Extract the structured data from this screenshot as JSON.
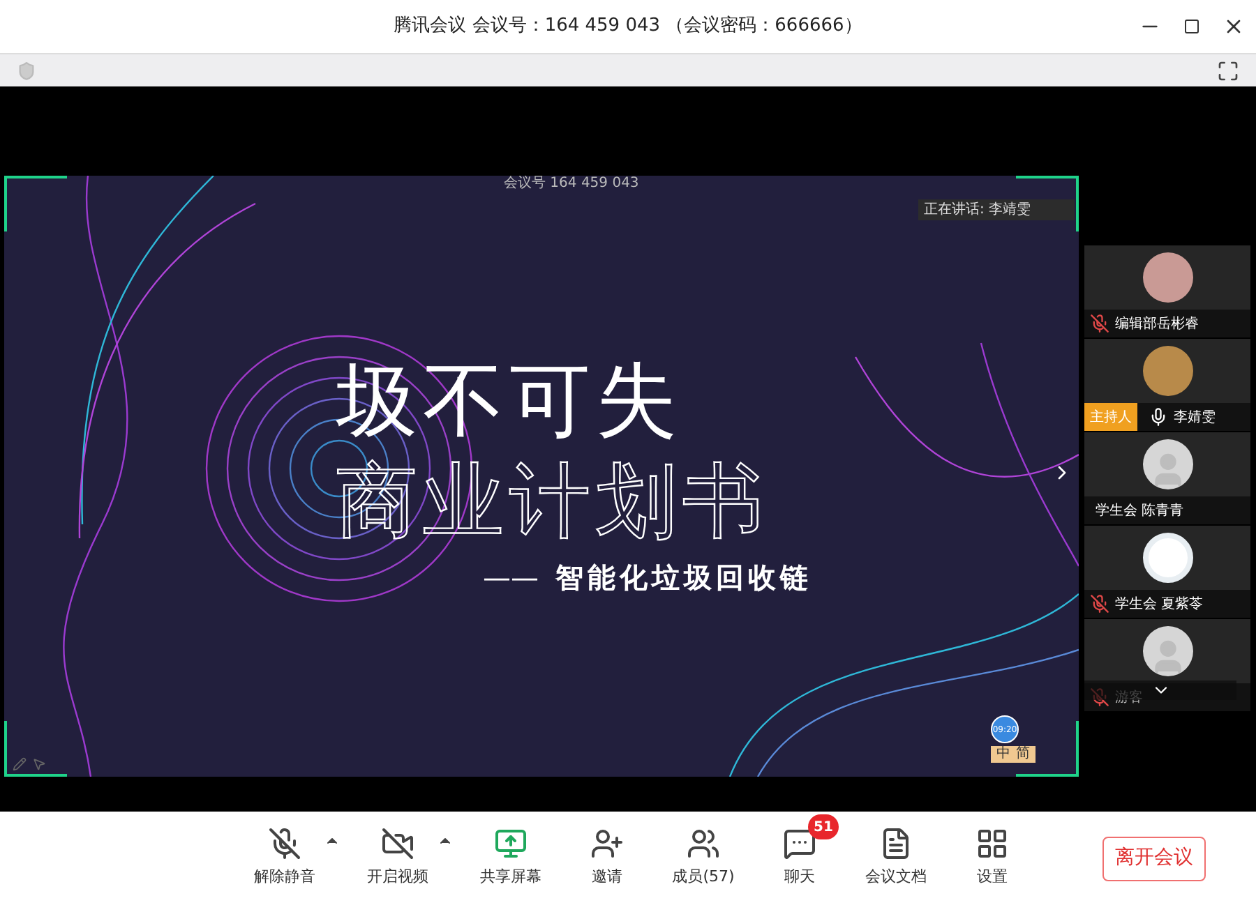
{
  "window": {
    "title": "腾讯会议 会议号：164 459 043 （会议密码：666666）"
  },
  "slide": {
    "meeting_label": "会议号 164 459 043",
    "speaker_label": "正在讲话: 李靖雯",
    "title": "圾不可失",
    "subtitle": "商业计划书",
    "tagline_dash": "——",
    "tagline": "智能化垃圾回收链",
    "clock": "09:20",
    "ime": [
      "中",
      "简"
    ]
  },
  "participants": [
    {
      "name": "编辑部岳彬睿",
      "kind": "photo",
      "muted": true,
      "host": false
    },
    {
      "name": "李婧雯",
      "kind": "cartoon",
      "muted": false,
      "host": true,
      "host_label": "主持人"
    },
    {
      "name": "学生会 陈青青",
      "kind": "default",
      "host": false
    },
    {
      "name": "学生会 夏紫苓",
      "kind": "drawing",
      "muted": true,
      "host": false
    },
    {
      "name": "游客",
      "kind": "default",
      "muted": true,
      "host": false,
      "covered": true
    }
  ],
  "toolbar": [
    {
      "kind": "mic",
      "label": "解除静音",
      "off": true,
      "caret": true
    },
    {
      "kind": "video",
      "label": "开启视频",
      "off": true,
      "caret": true
    },
    {
      "kind": "share",
      "label": "共享屏幕"
    },
    {
      "kind": "invite",
      "label": "邀请"
    },
    {
      "kind": "members",
      "label": "成员(57)"
    },
    {
      "kind": "chat",
      "label": "聊天",
      "badge": "51"
    },
    {
      "kind": "docs",
      "label": "会议文档"
    },
    {
      "kind": "settings",
      "label": "设置"
    }
  ],
  "leave_button": "离开会议"
}
